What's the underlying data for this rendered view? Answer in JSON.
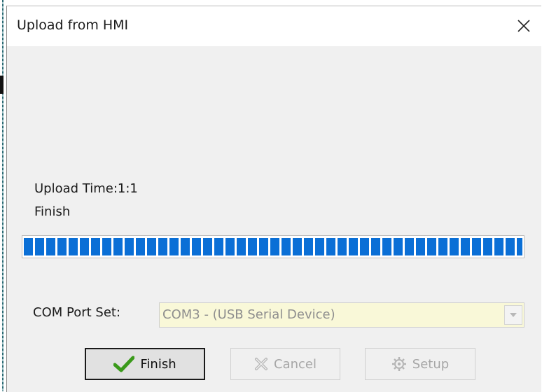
{
  "dialog": {
    "title": "Upload from HMI",
    "close_icon": "close-icon"
  },
  "status": {
    "upload_time": "Upload Time:1:1",
    "state": "Finish"
  },
  "progress": {
    "percent": 100,
    "color": "#0a6fd6"
  },
  "com_port": {
    "label": "COM Port Set:",
    "selected": "COM3 - (USB Serial Device)",
    "arrow_icon": "chevron-down-icon"
  },
  "buttons": {
    "finish": {
      "label": "Finish",
      "icon": "checkmark-icon",
      "color": "#3a9a1a"
    },
    "cancel": {
      "label": "Cancel",
      "icon": "x-icon",
      "enabled": false
    },
    "setup": {
      "label": "Setup",
      "icon": "gear-icon",
      "enabled": false
    }
  }
}
